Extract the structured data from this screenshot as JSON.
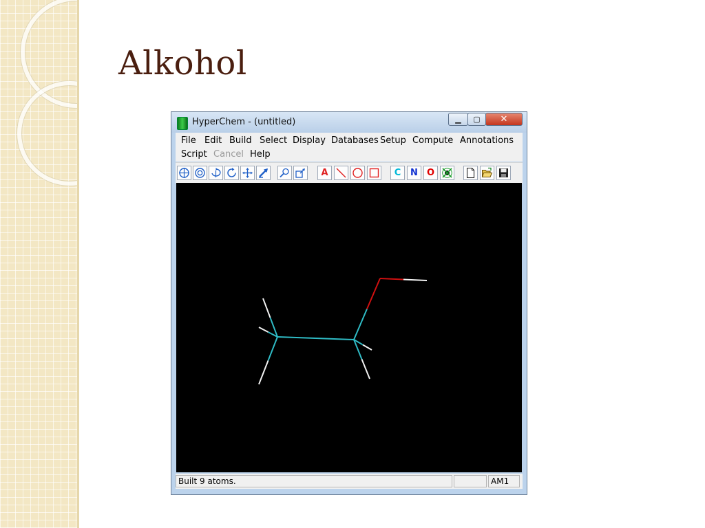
{
  "slide": {
    "title": "Alkohol"
  },
  "window": {
    "title": "HyperChem - (untitled)",
    "controls": {
      "minimize": "▁",
      "maximize": "▢",
      "close": "✕"
    }
  },
  "menu": {
    "row1": [
      "File",
      "Edit",
      "Build",
      "Select",
      "Display",
      "Databases",
      "Setup",
      "Compute",
      "Annotations"
    ],
    "row2": [
      "Script",
      "Cancel",
      "Help"
    ],
    "disabled": [
      "Cancel"
    ]
  },
  "toolbar": {
    "groups": [
      [
        "draw-tool",
        "select-tool",
        "rotate-out-of-plane-tool",
        "rotate-in-plane-tool",
        "translate-tool",
        "z-translate-tool",
        "zoom-tool",
        "z-clip-tool"
      ],
      [
        "text-annotation-tool",
        "line-annotation-tool",
        "ellipse-annotation-tool",
        "rectangle-annotation-tool"
      ],
      [
        "carbon-element",
        "nitrogen-element",
        "oxygen-element",
        "periodic-table"
      ],
      [
        "new-file",
        "open-file",
        "save-file"
      ]
    ],
    "labels": {
      "text": "A",
      "carbon": "C",
      "nitrogen": "N",
      "oxygen": "O"
    },
    "colors": {
      "annotation": "#e02020",
      "carbon": "#00b8d8",
      "nitrogen": "#1030d0",
      "oxygen": "#e00000",
      "tool": "#2060c8"
    }
  },
  "molecule": {
    "colors": {
      "carbon": "#2fbcc6",
      "oxygen": "#d01010",
      "hydrogen": "#f2f2f2"
    },
    "bonds": [
      {
        "from": "C1",
        "to": "C2",
        "type": "C-C"
      },
      {
        "from": "C2",
        "to": "O",
        "type": "C-O"
      },
      {
        "from": "O",
        "to": "HO",
        "type": "O-H"
      },
      {
        "from": "C1",
        "to": "H1a",
        "type": "C-H"
      },
      {
        "from": "C1",
        "to": "H1b",
        "type": "C-H"
      },
      {
        "from": "C1",
        "to": "H1c",
        "type": "C-H"
      },
      {
        "from": "C2",
        "to": "H2a",
        "type": "C-H"
      },
      {
        "from": "C2",
        "to": "H2b",
        "type": "C-H"
      }
    ]
  },
  "status": {
    "message": "Built 9 atoms.",
    "middle": "",
    "method": "AM1"
  }
}
